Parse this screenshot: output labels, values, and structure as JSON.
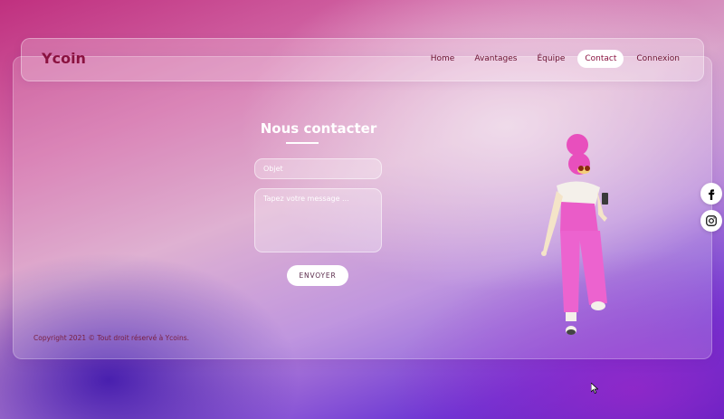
{
  "brand": {
    "name": "Ycoin"
  },
  "nav": {
    "items": [
      {
        "label": "Home",
        "active": false
      },
      {
        "label": "Avantages",
        "active": false
      },
      {
        "label": "Équipe",
        "active": false
      },
      {
        "label": "Contact",
        "active": true
      },
      {
        "label": "Connexion",
        "active": false
      }
    ]
  },
  "contact": {
    "title": "Nous contacter",
    "subject_placeholder": "Objet",
    "message_placeholder": "Tapez votre message ...",
    "submit_label": "ENVOYER"
  },
  "footer": {
    "copyright": "Copyright 2021 © Tout droit réservé à Ycoins."
  },
  "social": {
    "icons": [
      "facebook-icon",
      "instagram-icon"
    ]
  },
  "colors": {
    "brand": "#8a1240",
    "accent_pink": "#e94fc0",
    "background_purple": "#6a35d4"
  }
}
